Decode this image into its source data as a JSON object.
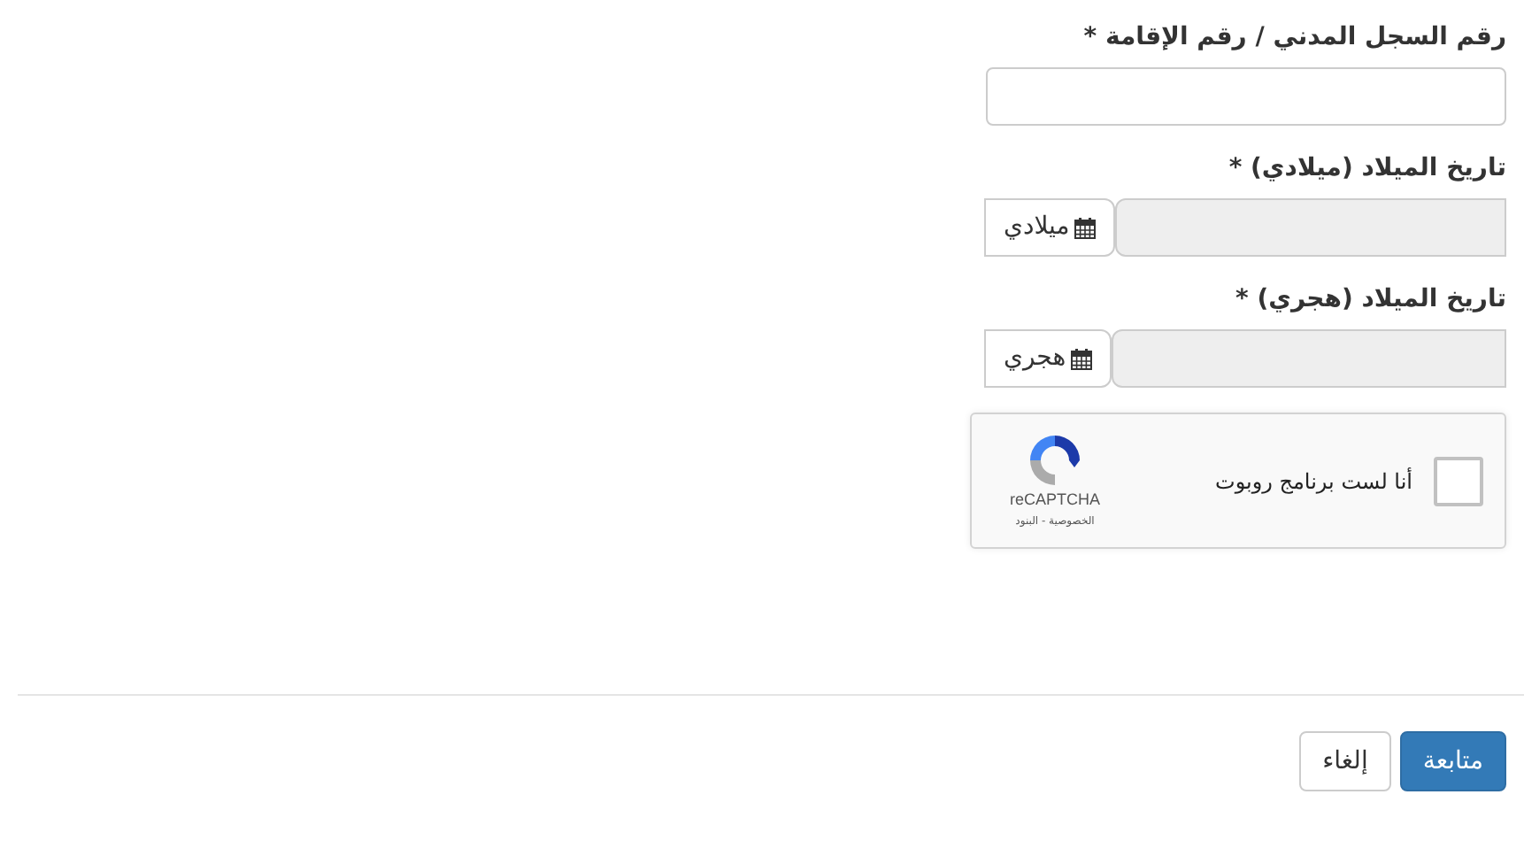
{
  "fields": [
    {
      "kind": "text",
      "label": "رقم السجل المدني / رقم الإقامة *"
    },
    {
      "kind": "date",
      "label": "تاريخ الميلاد (ميلادي) *",
      "button": "ميلادي"
    },
    {
      "kind": "date",
      "label": "تاريخ الميلاد (هجري) *",
      "button": "هجري"
    }
  ],
  "captcha": {
    "label": "أنا لست برنامج روبوت",
    "checked": false,
    "brand": "reCAPTCHA",
    "links": "الخصوصية - البنود"
  },
  "buttons": [
    {
      "label": "متابعة",
      "kind": "primary"
    },
    {
      "label": "إلغاء",
      "kind": "secondary"
    }
  ]
}
